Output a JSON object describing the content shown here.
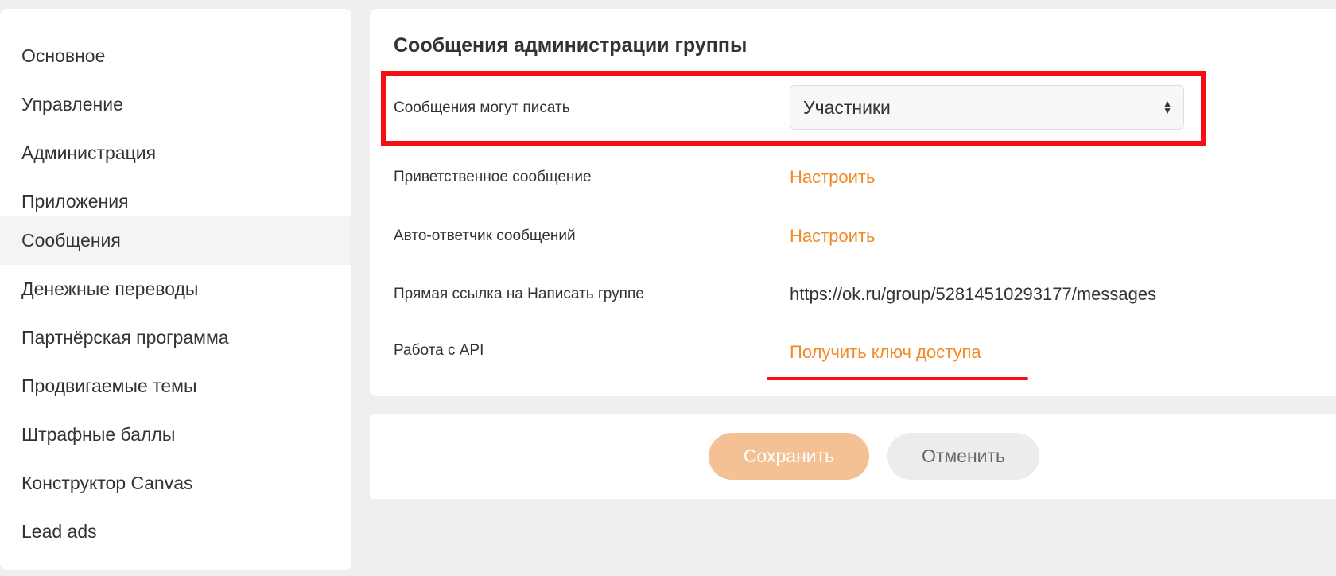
{
  "sidebar": {
    "items": [
      {
        "label": "Основное"
      },
      {
        "label": "Управление"
      },
      {
        "label": "Администрация"
      },
      {
        "label": "Приложения"
      },
      {
        "label": "Сообщения",
        "active": true
      },
      {
        "label": "Денежные переводы"
      },
      {
        "label": "Партнёрская программа"
      },
      {
        "label": "Продвигаемые темы"
      },
      {
        "label": "Штрафные баллы"
      },
      {
        "label": "Конструктор Canvas"
      },
      {
        "label": "Lead ads"
      }
    ]
  },
  "main": {
    "title": "Сообщения администрации группы",
    "rows": [
      {
        "label": "Сообщения могут писать",
        "value": "Участники"
      },
      {
        "label": "Приветственное сообщение",
        "value": "Настроить"
      },
      {
        "label": "Авто-ответчик сообщений",
        "value": "Настроить"
      },
      {
        "label": "Прямая ссылка на Написать группе",
        "value": "https://ok.ru/group/52814510293177/messages"
      },
      {
        "label": "Работа с API",
        "value": "Получить ключ доступа"
      }
    ]
  },
  "footer": {
    "save_label": "Сохранить",
    "cancel_label": "Отменить"
  },
  "colors": {
    "accent": "#f08a24",
    "annotation": "#f50f14",
    "save_button": "#f4c194"
  }
}
